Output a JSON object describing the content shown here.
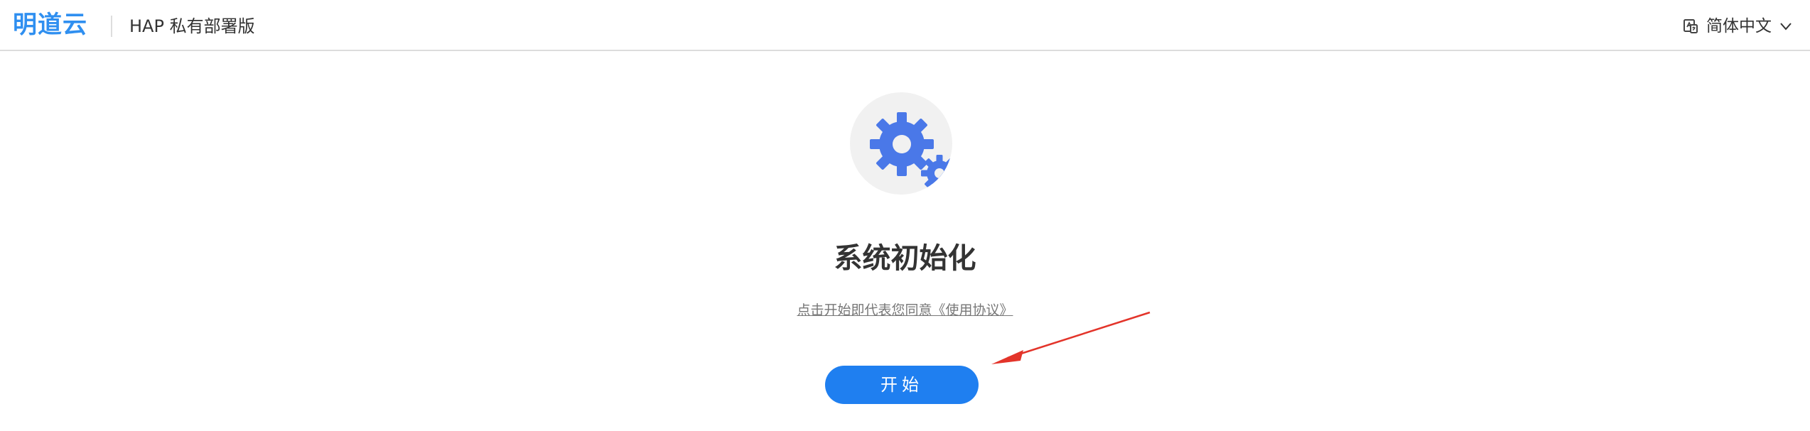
{
  "header": {
    "brand": "明道云",
    "product_title": "HAP 私有部署版",
    "language": {
      "label": "简体中文",
      "icon": "language-icon",
      "chevron_icon": "chevron-down-icon"
    }
  },
  "hero": {
    "icon": "gears-icon",
    "title": "系统初始化",
    "agreement_text": "点击开始即代表您同意《使用协议》",
    "start_label": "开始"
  },
  "annotation": {
    "icon": "red-arrow-icon"
  },
  "colors": {
    "accent": "#1f7ff0",
    "brand": "#2f8ff0",
    "gear": "#4a78e8",
    "arrow": "#e3342a"
  }
}
